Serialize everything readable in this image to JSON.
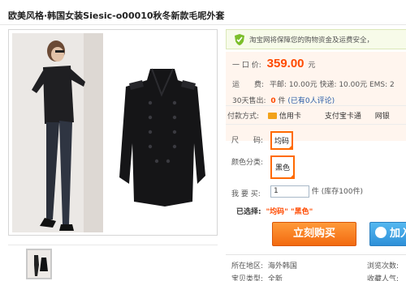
{
  "product": {
    "title": "欧美风格·韩国女装Siesic-o00010秋冬新款毛呢外套"
  },
  "guarantee": {
    "text": "淘宝网将保障您的购物资金及运费安全，"
  },
  "price": {
    "label": "一 口 价:",
    "value": "359.00",
    "unit": "元"
  },
  "shipping": {
    "label": "运　　费:",
    "text": "平邮: 10.00元  快递: 10.00元  EMS: 2"
  },
  "sales": {
    "label": "30天售出:",
    "count": "0",
    "count_unit": "件",
    "reviews_link": "(已有0人评论)"
  },
  "payment": {
    "label": "付款方式:",
    "methods": [
      "信用卡",
      "支付宝卡通",
      "网银"
    ]
  },
  "options": {
    "size_label": "尺　　码:",
    "size_value": "均码",
    "color_label": "颜色分类:",
    "color_value": "黑色"
  },
  "quantity": {
    "label": "我 要 买:",
    "value": "1",
    "unit": "件",
    "stock": "(库存100件)"
  },
  "selected": {
    "label": "已选择:",
    "value": "\"均码\" \"黑色\""
  },
  "buttons": {
    "buy_now": "立刻购买",
    "add_to_cart": "加入"
  },
  "meta": {
    "location_label": "所在地区:",
    "location_value": "海外韩国",
    "views_label": "浏览次数:",
    "type_label": "宝贝类型:",
    "type_value": "全新",
    "favorites_label": "收藏人气:"
  },
  "colors": {
    "price": "#ff4a00",
    "accent_orange": "#ff6a00",
    "link_blue": "#2a5ea8",
    "cart_blue": "#2e90d8"
  }
}
